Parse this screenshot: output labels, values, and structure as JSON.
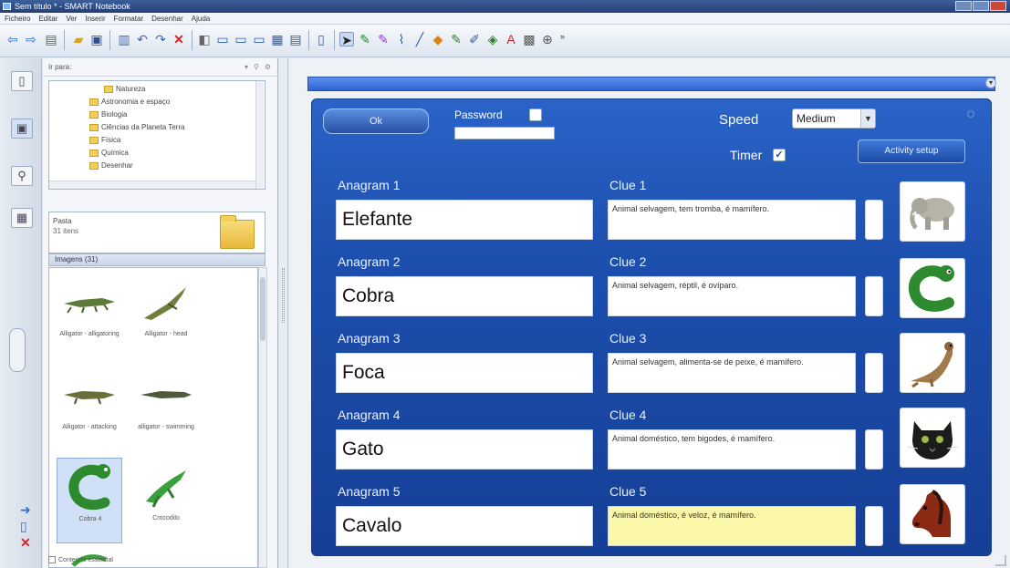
{
  "window": {
    "title": "Sem título * - SMART Notebook"
  },
  "menu": [
    "Ficheiro",
    "Editar",
    "Ver",
    "Inserir",
    "Formatar",
    "Desenhar",
    "Ajuda"
  ],
  "toolbar": {
    "more": "»"
  },
  "gallery": {
    "search_label": "Ir para:",
    "tree": [
      "Natureza",
      "Astronomia e espaço",
      "Biologia",
      "Ciências da Planeta Terra",
      "Física",
      "Química",
      "Desenhar"
    ],
    "info_title": "Pasta",
    "info_sub": "31 itens",
    "section": "Imagens (31)",
    "thumbs": [
      {
        "caption": "Alligator - alligatoring"
      },
      {
        "caption": "Alligator - head"
      },
      {
        "caption": "Alligator - attacking"
      },
      {
        "caption": "alligator - swimming"
      },
      {
        "caption": "Cobra 4"
      },
      {
        "caption": "Crocodilo"
      }
    ],
    "footer": "Conteúdo essential"
  },
  "activity": {
    "ok_label": "Ok",
    "password_label": "Password",
    "speed_label": "Speed",
    "speed_value": "Medium",
    "timer_label": "Timer",
    "group_button": "Activity setup",
    "rows": [
      {
        "anagram_label": "Anagram 1",
        "answer": "Elefante",
        "clue_label": "Clue 1",
        "clue": "Animal selvagem, tem tromba, é mamífero.",
        "picture": "elephant"
      },
      {
        "anagram_label": "Anagram 2",
        "answer": "Cobra",
        "clue_label": "Clue 2",
        "clue": "Animal selvagem, réptil, é ovíparo.",
        "picture": "snake"
      },
      {
        "anagram_label": "Anagram 3",
        "answer": "Foca",
        "clue_label": "Clue 3",
        "clue": "Animal selvagem, alimenta-se de peixe, é mamífero.",
        "picture": "seal"
      },
      {
        "anagram_label": "Anagram 4",
        "answer": "Gato",
        "clue_label": "Clue 4",
        "clue": "Animal doméstico, tem bigodes, é mamífero.",
        "picture": "cat"
      },
      {
        "anagram_label": "Anagram 5",
        "answer": "Cavalo",
        "clue_label": "Clue 5",
        "clue": "Animal doméstico, é veloz, é mamífero.",
        "picture": "horse"
      }
    ]
  }
}
